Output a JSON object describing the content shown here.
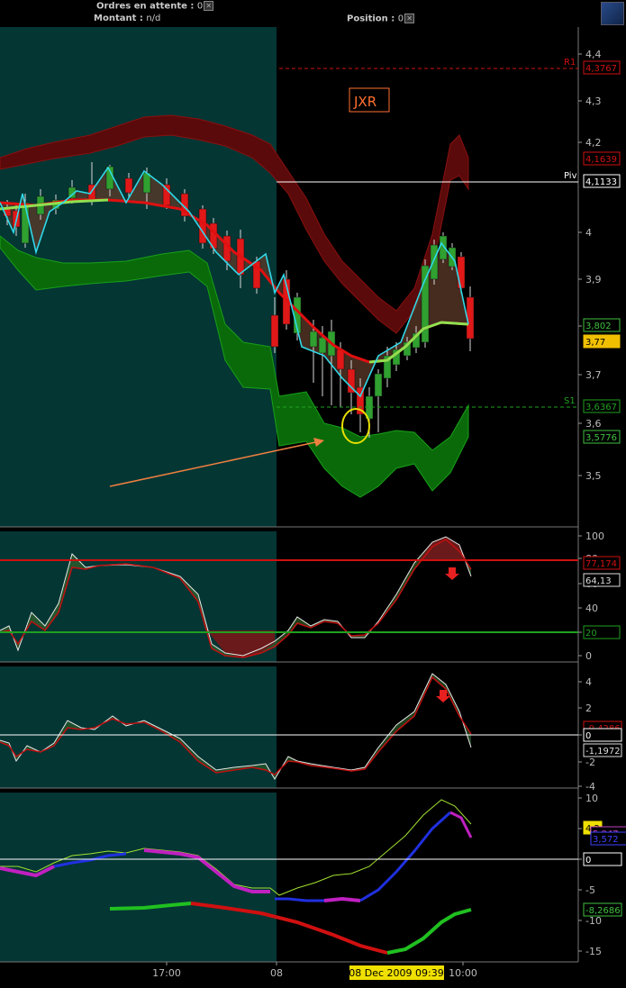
{
  "toolbar": {
    "orders_label": "Ordres en attente :",
    "orders_value": "0",
    "amount_label": "Montant :",
    "amount_value": "n/d",
    "position_label": "Position :",
    "position_value": "0"
  },
  "chart_data": {
    "type": "line",
    "symbol": "JXR",
    "price_panel": {
      "y_ticks": [
        "4,4",
        "4,3",
        "4,2",
        "4",
        "3,9",
        "3,8",
        "3,7",
        "3,6",
        "3,5"
      ],
      "levels": [
        {
          "name": "R1",
          "label": "4,3767",
          "color": "#d01010"
        },
        {
          "name": "Piv",
          "label": "4,1133",
          "color": "#ffffff"
        },
        {
          "name": "S1",
          "label": "3,6367",
          "color": "#20a020"
        }
      ],
      "tags": [
        {
          "label": "4,1639",
          "color": "#d01010"
        },
        {
          "label": "3,802",
          "color": "#40c040"
        },
        {
          "label": "3,77",
          "color": "#f0c000"
        },
        {
          "label": "3,5776",
          "color": "#40c040"
        }
      ]
    },
    "osc1_panel": {
      "y_ticks": [
        "100",
        "80",
        "60",
        "40",
        "20",
        "0"
      ],
      "tags": [
        {
          "label": "77,174",
          "color": "#d01010"
        },
        {
          "label": "64,13",
          "color": "#dddddd"
        },
        {
          "label": "20",
          "color": "#20a020"
        }
      ]
    },
    "osc2_panel": {
      "y_ticks": [
        "4",
        "2",
        "0",
        "-2",
        "-4"
      ],
      "tags": [
        {
          "label": "-0,4286",
          "color": "#d01010"
        },
        {
          "label": "0",
          "color": "#ffffff"
        },
        {
          "label": "-1,1972",
          "color": "#dddddd"
        }
      ]
    },
    "osc3_panel": {
      "y_ticks": [
        "10",
        "5",
        "0",
        "-5",
        "-10",
        "-15"
      ],
      "tags": [
        {
          "label": "4,2",
          "color": "#f0e000"
        },
        {
          "label": "5,847",
          "color": "#c040c0"
        },
        {
          "label": "3,572",
          "color": "#4040ff"
        },
        {
          "label": "0",
          "color": "#ffffff"
        },
        {
          "label": "-8,2686",
          "color": "#40c040"
        }
      ]
    },
    "x_labels": [
      "17:00",
      "08",
      "10:00"
    ],
    "cursor_time": "08 Dec 2009 09:39"
  }
}
